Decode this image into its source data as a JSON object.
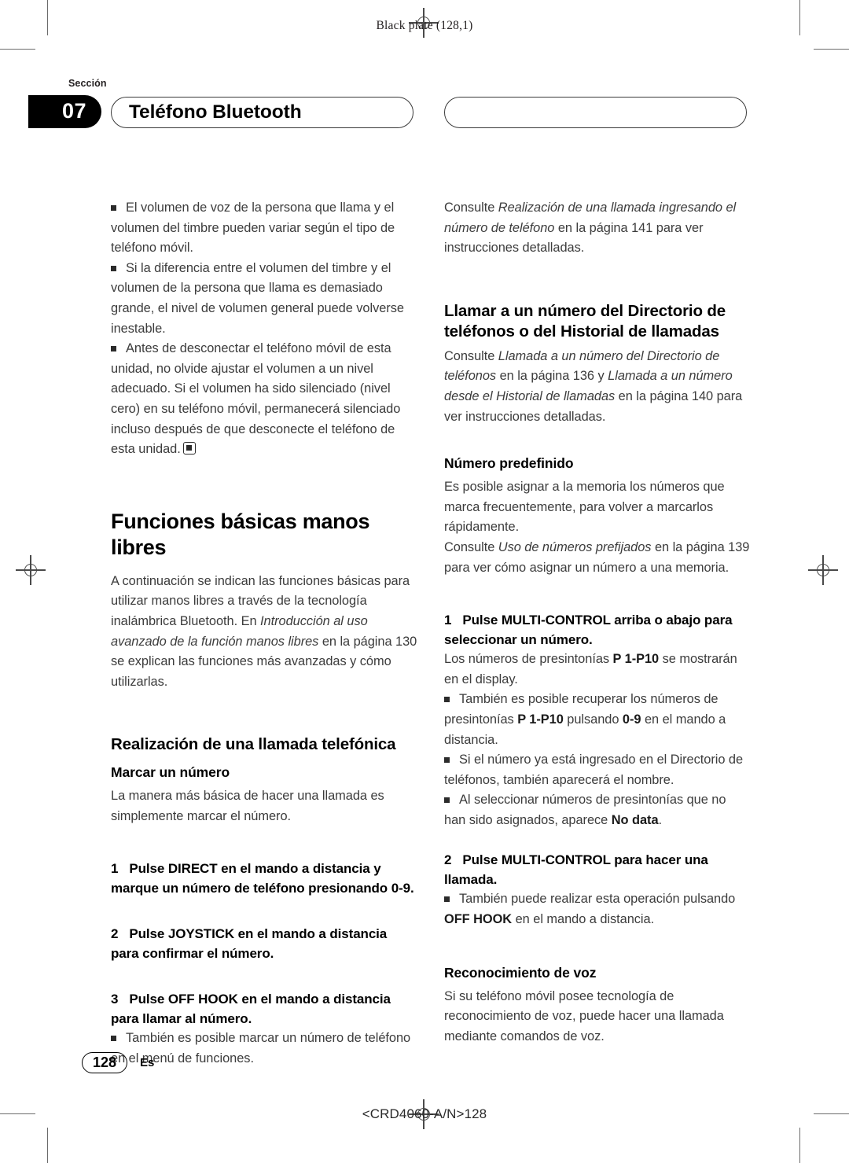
{
  "print_marks": {
    "black_plate": "Black plate (128,1)"
  },
  "header": {
    "section_label": "Sección",
    "section_number": "07",
    "chapter_title": "Teléfono Bluetooth"
  },
  "footer": {
    "page_number": "128",
    "language_code": "Es",
    "document_code": "<CRD4060-A/N>128"
  },
  "left_column": {
    "notes_1": [
      "El volumen de voz de la persona que llama y el volumen del timbre pueden variar según el tipo de teléfono móvil.",
      "Si la diferencia entre el volumen del timbre y el volumen de la persona que llama es demasiado grande, el nivel de volumen general puede volverse inestable.",
      "Antes de desconectar el teléfono móvil de esta unidad, no olvide ajustar el volumen a un nivel adecuado. Si el volumen ha sido silenciado (nivel cero) en su teléfono móvil, permanecerá silenciado incluso después de que desconecte el teléfono de esta unidad."
    ],
    "heading_main": "Funciones básicas manos libres",
    "intro_part1": "A continuación se indican las funciones básicas para utilizar manos libres a través de la tecnología inalámbrica Bluetooth. En ",
    "intro_italic": "Introducción al uso avanzado de la función manos libres",
    "intro_part2": " en la página 130 se explican las funciones más avanzadas y cómo utilizarlas.",
    "heading_call": "Realización de una llamada telefónica",
    "subheading_dial": "Marcar un número",
    "dial_body": "La manera más básica de hacer una llamada es simplemente marcar el número.",
    "steps": [
      {
        "n": "1",
        "text": "Pulse DIRECT en el mando a distancia y marque un número de teléfono presionando 0-9."
      },
      {
        "n": "2",
        "text": "Pulse JOYSTICK en el mando a distancia para confirmar el número."
      },
      {
        "n": "3",
        "text": "Pulse OFF HOOK en el mando a distancia para llamar al número."
      }
    ],
    "note_after_step3": "También es posible marcar un número de teléfono en el menú de funciones."
  },
  "right_column": {
    "ref_top_pre": "Consulte ",
    "ref_top_italic": "Realización de una llamada ingresando el número de teléfono",
    "ref_top_post": " en la página 141 para ver instrucciones detalladas.",
    "heading_directory": "Llamar a un número del Directorio de teléfonos o del Historial de llamadas",
    "dir_pre": "Consulte ",
    "dir_italic_1": "Llamada a un número del Directorio de teléfonos",
    "dir_mid": " en la página 136 y ",
    "dir_italic_2": "Llamada a un número desde el Historial de llamadas",
    "dir_post": " en la página 140 para ver instrucciones detalladas.",
    "subheading_preset": "Número predefinido",
    "preset_body": "Es posible asignar a la memoria los números que marca frecuentemente, para volver a marcarlos rápidamente.",
    "preset_ref_pre": "Consulte ",
    "preset_ref_italic": "Uso de números prefijados",
    "preset_ref_post": " en la página 139 para ver cómo asignar un número a una memoria.",
    "step1_n": "1",
    "step1_text": "Pulse MULTI-CONTROL arriba o abajo para seleccionar un número.",
    "step1_body_pre": "Los números de presintonías ",
    "step1_body_bold": "P 1-P10",
    "step1_body_post": " se mostrarán en el display.",
    "step1_notes": [
      {
        "pre": "También es posible recuperar los números de presintonías ",
        "b1": "P 1-P10",
        "mid": " pulsando ",
        "b2": "0-9",
        "post": " en el mando a distancia."
      },
      {
        "pre": "Si el número ya está ingresado en el Directorio de teléfonos, también aparecerá el nombre.",
        "b1": "",
        "mid": "",
        "b2": "",
        "post": ""
      },
      {
        "pre": "Al seleccionar números de presintonías que no han sido asignados, aparece ",
        "b1": "No data",
        "mid": "",
        "b2": "",
        "post": "."
      }
    ],
    "step2_n": "2",
    "step2_text": "Pulse MULTI-CONTROL para hacer una llamada.",
    "step2_note_pre": "También puede realizar esta operación pulsando ",
    "step2_note_bold": "OFF HOOK",
    "step2_note_post": " en el mando a distancia.",
    "subheading_voice": "Reconocimiento de voz",
    "voice_body": "Si su teléfono móvil posee tecnología de reconocimiento de voz, puede hacer una llamada mediante comandos de voz."
  },
  "colors": {
    "ink": "#231f20",
    "accent": "#000000",
    "body": "#3c3c3c"
  }
}
